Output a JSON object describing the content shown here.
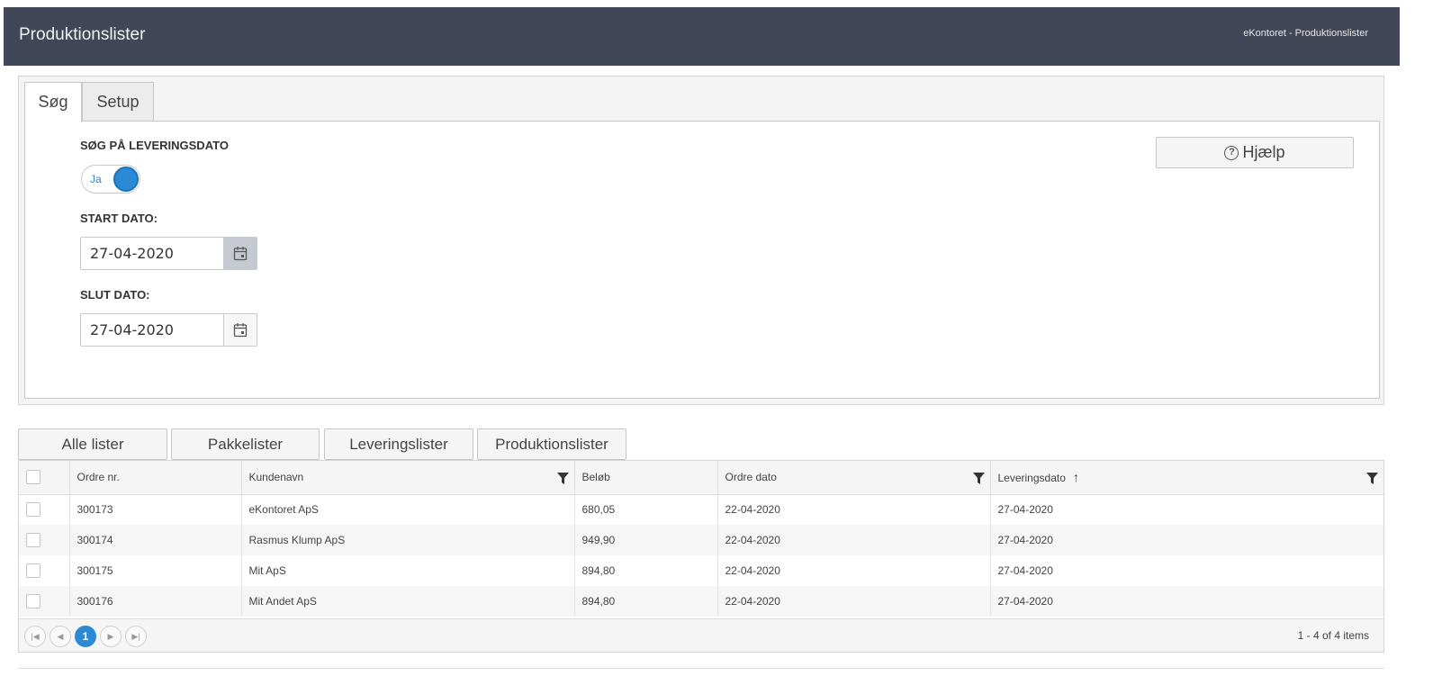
{
  "header": {
    "title": "Produktionslister",
    "breadcrumb": "eKontoret - Produktionslister"
  },
  "tabs": [
    {
      "label": "Søg",
      "active": true
    },
    {
      "label": "Setup",
      "active": false
    }
  ],
  "search": {
    "delivery_label": "SØG PÅ LEVERINGSDATO",
    "toggle_label": "Ja",
    "toggle_on": true,
    "start_label": "START DATO:",
    "start_value": "27-04-2020",
    "end_label": "SLUT DATO:",
    "end_value": "27-04-2020",
    "help_label": "Hjælp",
    "help_icon": "question-circle-icon"
  },
  "filters": [
    "Alle lister",
    "Pakkelister",
    "Leveringslister",
    "Produktionslister"
  ],
  "grid": {
    "columns": [
      "Ordre nr.",
      "Kundenavn",
      "Beløb",
      "Ordre dato",
      "Leveringsdato"
    ],
    "rows": [
      [
        "300173",
        "eKontoret ApS",
        "680,05",
        "22-04-2020",
        "27-04-2020"
      ],
      [
        "300174",
        "Rasmus Klump ApS",
        "949,90",
        "22-04-2020",
        "27-04-2020"
      ],
      [
        "300175",
        "Mit ApS",
        "894,80",
        "22-04-2020",
        "27-04-2020"
      ],
      [
        "300176",
        "Mit Andet ApS",
        "894,80",
        "22-04-2020",
        "27-04-2020"
      ]
    ],
    "sort_column": "Leveringsdato",
    "sort_direction": "ascending"
  },
  "pager": {
    "current_page": "1",
    "info": "1 - 4 of 4 items"
  },
  "colors": {
    "header_bg": "#414756",
    "accent": "#2b8ad6"
  }
}
